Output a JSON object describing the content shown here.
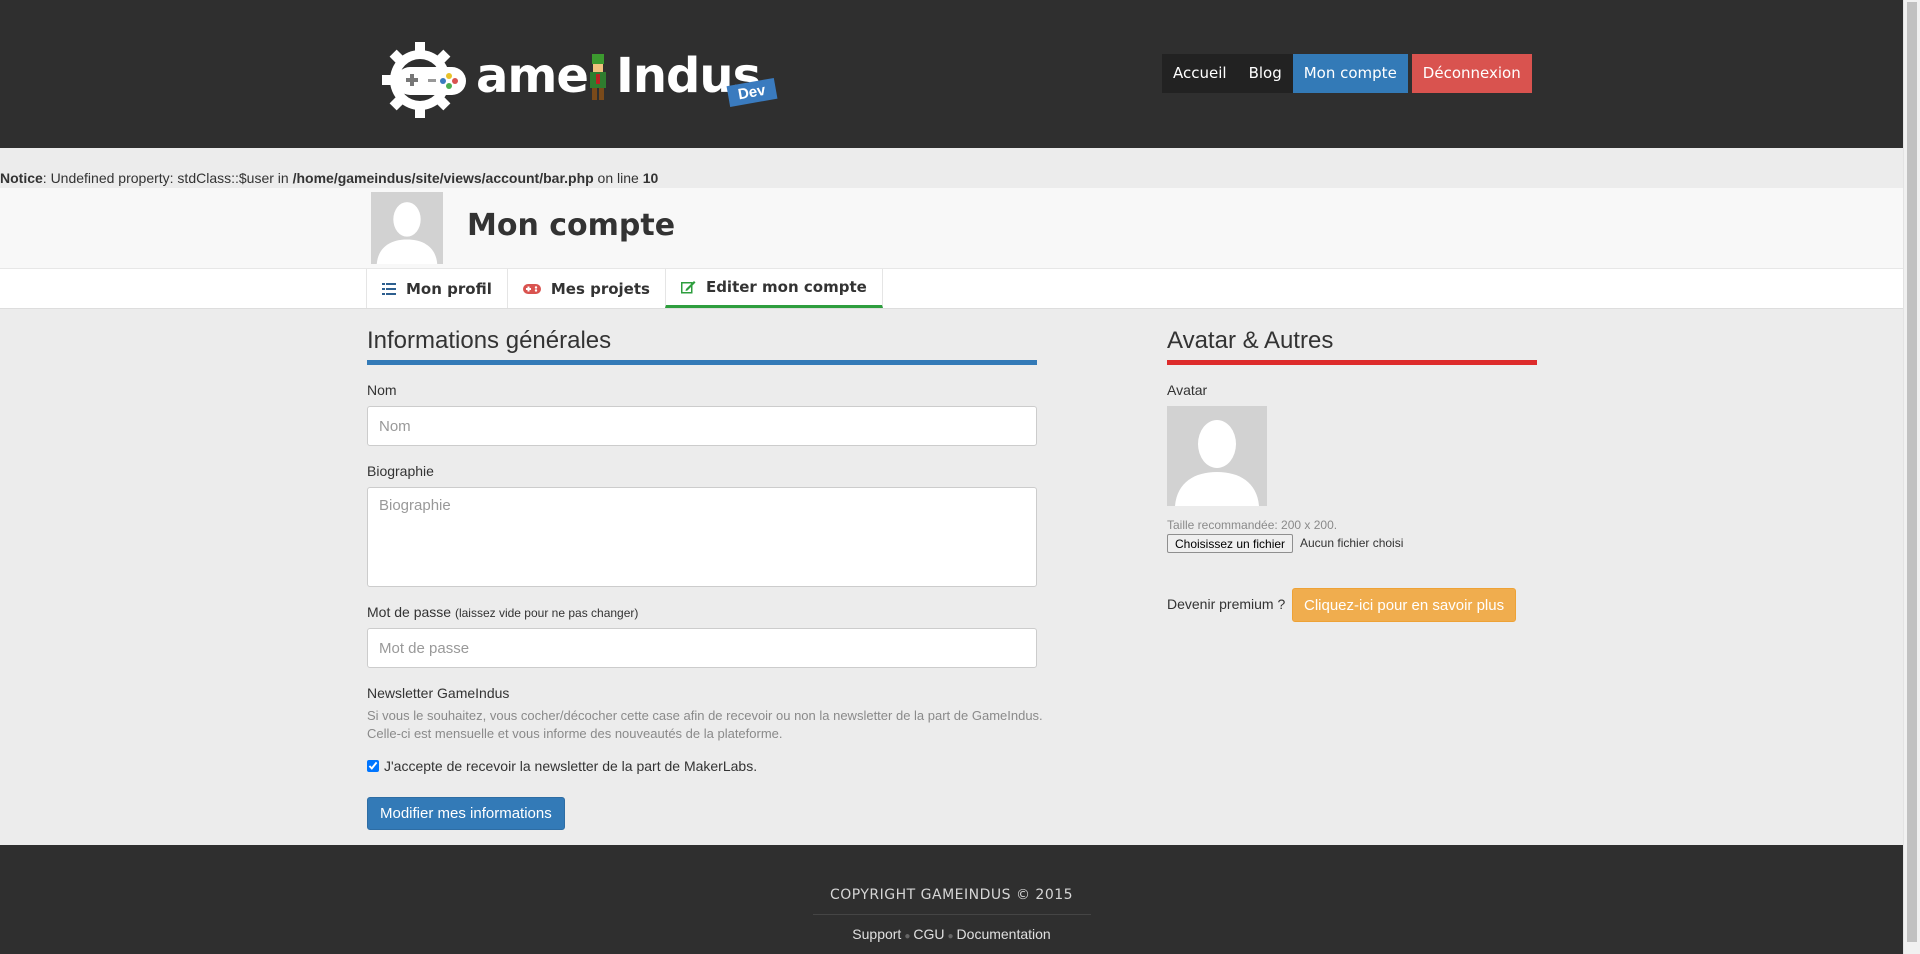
{
  "header": {
    "logo": {
      "text_left": "ame",
      "text_right": "Indus",
      "badge": "Dev"
    },
    "nav": [
      "Accueil",
      "Blog",
      "Mon compte",
      "Déconnexion"
    ]
  },
  "notice": {
    "label": "Notice",
    "message": ": Undefined property: stdClass::$user in ",
    "path": "/home/gameindus/site/views/account/bar.php",
    "on_line": " on line ",
    "line": "10"
  },
  "account": {
    "title": "Mon compte",
    "tabs": [
      "Mon profil",
      "Mes projets",
      "Editer mon compte"
    ]
  },
  "general": {
    "title": "Informations générales",
    "name_label": "Nom",
    "name_placeholder": "Nom",
    "bio_label": "Biographie",
    "bio_placeholder": "Biographie",
    "password_label": "Mot de passe",
    "password_hint": "(laissez vide pour ne pas changer)",
    "password_placeholder": "Mot de passe",
    "newsletter_label": "Newsletter GameIndus",
    "newsletter_help_1": "Si vous le souhaitez, vous cocher/décocher cette case afin de recevoir ou non la newsletter de la part de GameIndus.",
    "newsletter_help_2": "Celle-ci est mensuelle et vous informe des nouveautés de la plateforme.",
    "newsletter_checkbox": "J'accepte de recevoir la newsletter de la part de MakerLabs.",
    "newsletter_checked": true,
    "submit": "Modifier mes informations"
  },
  "avatar_section": {
    "title": "Avatar & Autres",
    "avatar_label": "Avatar",
    "size_hint": "Taille recommandée: 200 x 200.",
    "file_button": "Choisissez un fichier",
    "file_status": "Aucun fichier choisi",
    "premium_label": "Devenir premium ?",
    "premium_button": "Cliquez-ici pour en savoir plus"
  },
  "footer": {
    "copyright": "COPYRIGHT GAMEINDUS © 2015",
    "links": [
      "Support",
      "CGU",
      "Documentation"
    ]
  },
  "colors": {
    "header_bg": "#2f2f2f",
    "primary": "#337ab7",
    "danger": "#d9534f",
    "warning": "#f0ad4e",
    "tab_active": "#2e9e3e",
    "rule_general": "#337ab7",
    "rule_avatar": "#dd2b2b"
  }
}
